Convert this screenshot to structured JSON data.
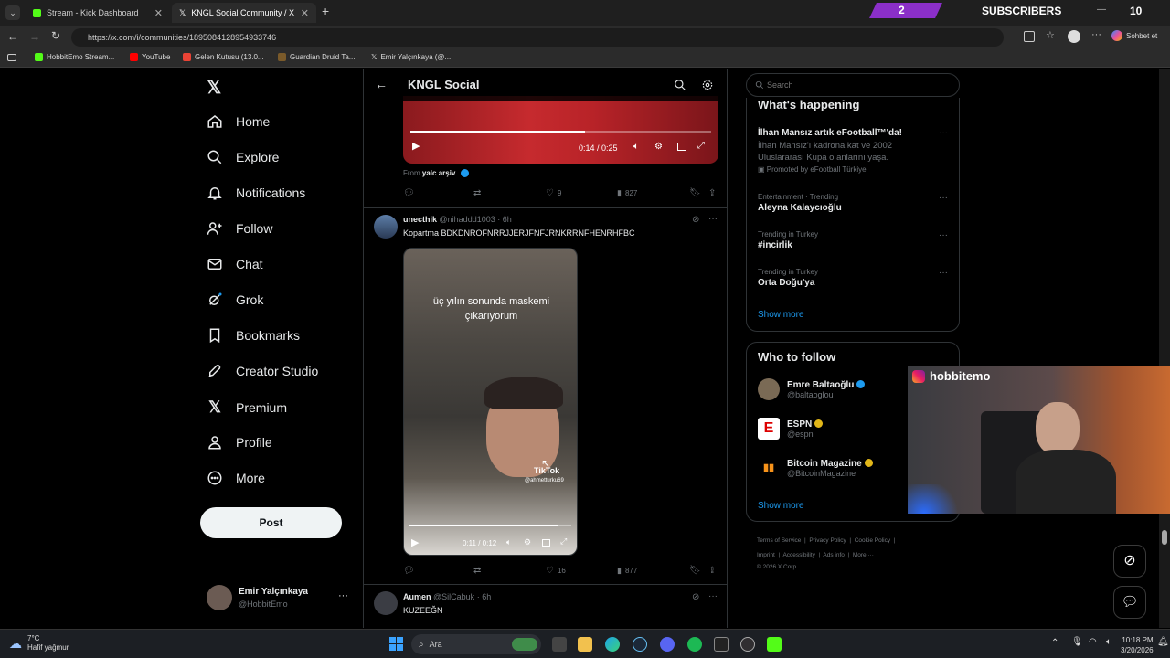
{
  "browser": {
    "tabs": [
      {
        "label": "Stream - Kick Dashboard"
      },
      {
        "label": "KNGL Social Community / X"
      }
    ],
    "url": "https://x.com/i/communities/1895084128954933746",
    "bookmarks": [
      "HobbitEmo Stream...",
      "YouTube",
      "Gelen Kutusu (13.0...",
      "Guardian Druid Ta...",
      "Emir Yalçınkaya (@..."
    ],
    "chat_button": "Sohbet et"
  },
  "overlay": {
    "subscribers_count": "2",
    "subscribers_label": "SUBSCRIBERS",
    "top_right_count": "10",
    "instagram_handle": "hobbitemo"
  },
  "nav": {
    "items": [
      "Home",
      "Explore",
      "Notifications",
      "Follow",
      "Chat",
      "Grok",
      "Bookmarks",
      "Creator Studio",
      "Premium",
      "Profile",
      "More"
    ],
    "post_label": "Post",
    "user_name": "Emir Yalçınkaya",
    "user_handle": "@HobbitEmo"
  },
  "main": {
    "title": "KNGL Social",
    "post1": {
      "video_time": "0:14 / 0:25",
      "from_prefix": "From",
      "from_name": "yalc arşiv",
      "likes": "9",
      "views": "827"
    },
    "post2": {
      "name": "unecthik",
      "handle": "@nihaddd1003",
      "time": "· 6h",
      "text": "Kopartma BDKDNROFNRRJJERJFNFJRNKRRNFHENRHFBC",
      "video_caption_line1": "üç yılın sonunda maskemi",
      "video_caption_line2": "çıkarıyorum",
      "watermark_name": "TikTok",
      "watermark_handle": "@ahmetturku69",
      "video_time": "0:11 / 0:12",
      "likes": "16",
      "views": "877"
    },
    "post3": {
      "name": "Aumen",
      "handle": "@SilCabuk",
      "time": "· 6h",
      "text": "KUZEEĞN"
    }
  },
  "right": {
    "search_placeholder": "Search",
    "whats_happening_title": "What's happening",
    "trends": [
      {
        "title": "İlhan Mansız artık eFootball™'da!",
        "body": "İlhan Mansız'ı kadrona kat ve 2002 Uluslararası Kupa o anlarını yaşa.",
        "promoted": "Promoted by eFootball Türkiye"
      },
      {
        "meta": "Entertainment · Trending",
        "title": "Aleyna Kalaycıoğlu"
      },
      {
        "meta": "Trending in Turkey",
        "title": "#incirlik"
      },
      {
        "meta": "Trending in Turkey",
        "title": "Orta Doğu'ya"
      }
    ],
    "show_more": "Show more",
    "who_to_follow_title": "Who to follow",
    "follow": [
      {
        "name": "Emre Baltaoğlu",
        "handle": "@baltaoglou"
      },
      {
        "name": "ESPN",
        "handle": "@espn"
      },
      {
        "name": "Bitcoin Magazine",
        "handle": "@BitcoinMagazine"
      }
    ],
    "show_more_2": "Show more",
    "footer_line1": [
      "Terms of Service",
      "Privacy Policy",
      "Cookie Policy"
    ],
    "footer_line2": [
      "Imprint",
      "Accessibility",
      "Ads info",
      "More ···"
    ],
    "copyright": "© 2026 X Corp."
  },
  "taskbar": {
    "weather_temp": "7°C",
    "weather_desc": "Hafif yağmur",
    "search": "Ara",
    "time": "10:18 PM",
    "date": "3/20/2026"
  },
  "colors": {
    "accent": "#1d9bf0",
    "verified_gold": "#e2b719",
    "subscriber_banner": "#8b2fc9"
  }
}
